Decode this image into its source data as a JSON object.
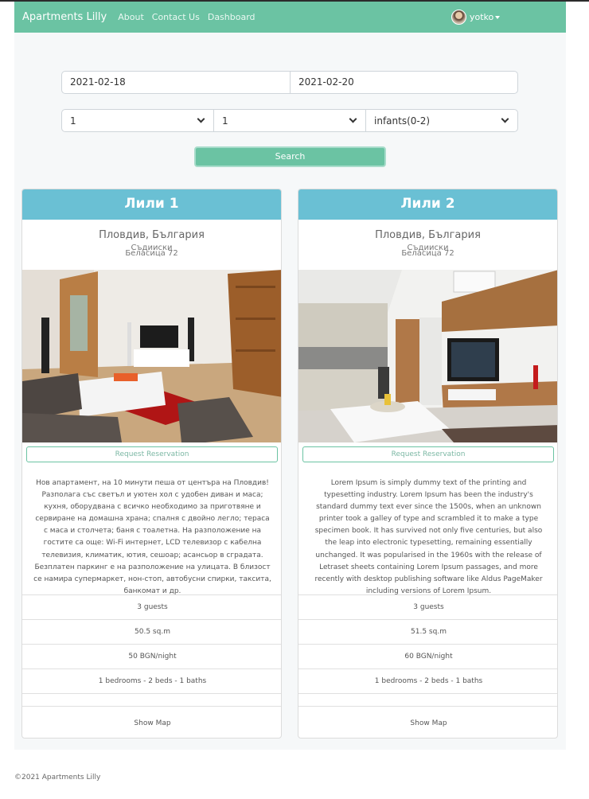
{
  "nav": {
    "brand": "Apartments Lilly",
    "links": [
      "About",
      "Contact Us",
      "Dashboard"
    ],
    "user": "yotko"
  },
  "search": {
    "check_in": "2021-02-18",
    "check_out": "2021-02-20",
    "select1": "1",
    "select2": "1",
    "select3": "infants(0-2)",
    "button": "Search"
  },
  "apartments": [
    {
      "title": "Лили 1",
      "city": "Пловдив, България",
      "district": "Съдииски",
      "street": "Беласица 72",
      "reserve": "Request Reservation",
      "description": "Нов апартамент, на 10 минути пеша от центъра на Пловдив! Разполага със светъл и уютен хол с удобен диван и маса; кухня, оборудвана с всичко необходимо за приготвяне и сервиране на домашна храна; спалня с двойно легло; тераса с маса и столчета; баня с тоалетна. На разположение на гостите са още: Wi-Fi интернет, LCD телевизор с кабелна телевизия, климатик, ютия, сешоар; асансьор в сградата. Безплатен паркинг е на разположение на улицата. В близост се намира супермаркет, нон-стоп, автобусни спирки, таксита, банкомат и др.",
      "guests": "3 guests",
      "area": "50.5 sq.m",
      "price": "50 BGN/night",
      "rooms": "1 bedrooms - 2 beds - 1 baths",
      "map": "Show Map"
    },
    {
      "title": "Лили 2",
      "city": "Пловдив, България",
      "district": "Съдииски",
      "street": "Беласица 72",
      "reserve": "Request Reservation",
      "description": "Lorem Ipsum is simply dummy text of the printing and typesetting industry. Lorem Ipsum has been the industry's standard dummy text ever since the 1500s, when an unknown printer took a galley of type and scrambled it to make a type specimen book. It has survived not only five centuries, but also the leap into electronic typesetting, remaining essentially unchanged. It was popularised in the 1960s with the release of Letraset sheets containing Lorem Ipsum passages, and more recently with desktop publishing software like Aldus PageMaker including versions of Lorem Ipsum.",
      "guests": "3 guests",
      "area": "51.5 sq.m",
      "price": "60 BGN/night",
      "rooms": "1 bedrooms - 2 beds - 1 baths",
      "map": "Show Map"
    }
  ],
  "footer": "©2021 Apartments Lilly",
  "colors": {
    "navbar": "#6bc3a3",
    "card_header": "#6ac0d4",
    "search_button": "#6bc3a3"
  }
}
